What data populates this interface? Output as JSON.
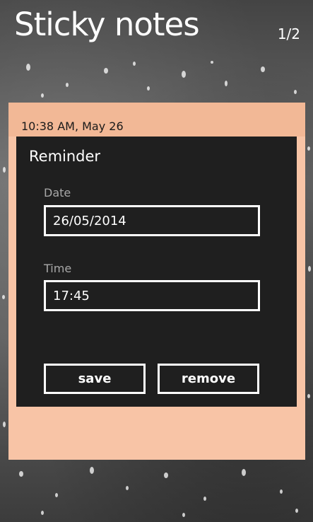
{
  "header": {
    "app_title": "Sticky notes",
    "page_indicator": "1/2"
  },
  "note": {
    "timestamp": "10:38 AM, May 26",
    "color": "#f8c4a6",
    "header_color": "#f2b896"
  },
  "reminder_dialog": {
    "title": "Reminder",
    "date_label": "Date",
    "date_value": "26/05/2014",
    "time_label": "Time",
    "time_value": "17:45",
    "save_label": "save",
    "remove_label": "remove"
  }
}
